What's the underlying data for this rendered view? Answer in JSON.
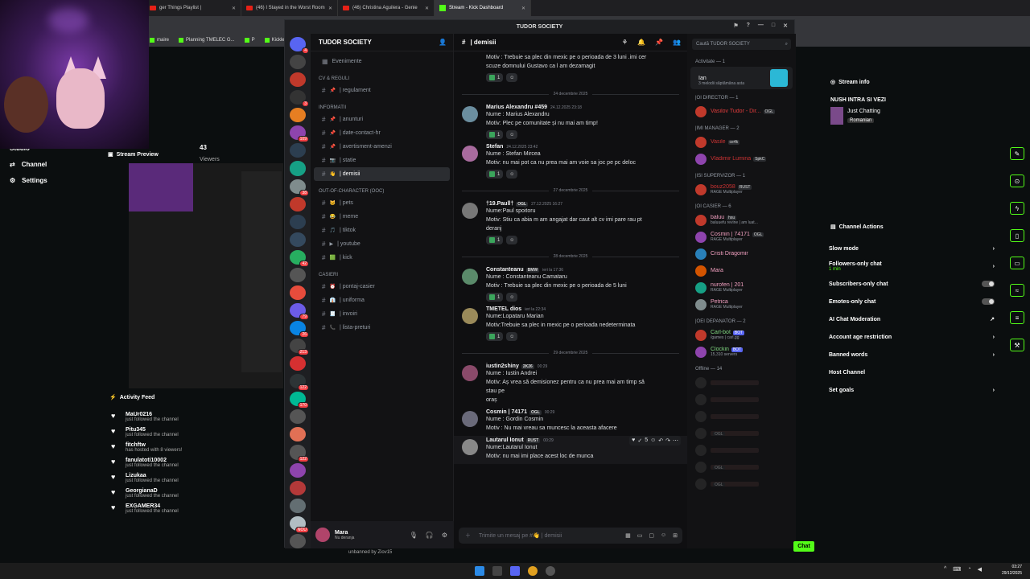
{
  "browser": {
    "tabs": [
      {
        "label": "ger Things Playlist |",
        "active": false
      },
      {
        "label": "(46) I Stayed in the Worst Room",
        "active": false
      },
      {
        "label": "(46) Christina Aguilera - Genie",
        "active": false
      },
      {
        "label": "Stream - Kick Dashboard",
        "active": true
      }
    ],
    "bookmarks": [
      "maire",
      "Planning TMELEC G...",
      "P",
      "Kicklet.app -"
    ]
  },
  "kick": {
    "nav": {
      "studio": "Studio",
      "channel": "Channel",
      "settings": "Settings"
    },
    "viewers": {
      "count": "43",
      "label": "Viewers"
    },
    "stream_preview_title": "Stream Preview",
    "activity_feed_title": "Activity Feed",
    "activity_feed": [
      {
        "name": "MaUr0216",
        "sub": "just followed the channel"
      },
      {
        "name": "Pitu345",
        "sub": "just followed the channel"
      },
      {
        "name": "fitchftw",
        "sub": "has hosted with 8 viewers!"
      },
      {
        "name": "fanulatoti10002",
        "sub": "just followed the channel"
      },
      {
        "name": "Lizukaa",
        "sub": "just followed the channel"
      },
      {
        "name": "GeorgianaD",
        "sub": "just followed the channel"
      },
      {
        "name": "EXGAMER34",
        "sub": "just followed the channel"
      }
    ],
    "stream_info": {
      "title": "Stream info",
      "stream_title": "NUSH INTRA SI VEZI",
      "category": "Just Chatting",
      "tag": "Romanian"
    },
    "channel_actions": {
      "title": "Channel Actions",
      "items": [
        {
          "label": "Slow mode",
          "control": "chevron"
        },
        {
          "label": "Followers-only chat",
          "sub": "1 min",
          "control": "chevron"
        },
        {
          "label": "Subscribers-only chat",
          "control": "toggle"
        },
        {
          "label": "Emotes-only chat",
          "control": "toggle"
        },
        {
          "label": "AI Chat Moderation",
          "control": "link"
        },
        {
          "label": "Account age restriction",
          "control": "chevron"
        },
        {
          "label": "Banned words",
          "control": "chevron"
        },
        {
          "label": "Host Channel",
          "control": "none"
        },
        {
          "label": "Set goals",
          "control": "chevron"
        }
      ]
    },
    "chat_button": "Chat",
    "unbanned_text": "unbanned by Ziov15"
  },
  "discord": {
    "window_title": "TUDOR SOCIETY",
    "guild_name": "TUDOR SOCIETY",
    "categories": [
      {
        "name": "",
        "channels": [
          {
            "emoji": "",
            "name": "Evenimente",
            "type": "event"
          }
        ]
      },
      {
        "name": "CV & REGULI",
        "channels": [
          {
            "emoji": "📌",
            "name": "| regulament"
          }
        ]
      },
      {
        "name": "INFORMATII",
        "channels": [
          {
            "emoji": "📌",
            "name": "| anunturi"
          },
          {
            "emoji": "📌",
            "name": "| date-contact-hr"
          },
          {
            "emoji": "📌",
            "name": "| avertisment-amenzi"
          },
          {
            "emoji": "📷",
            "name": "| statie"
          },
          {
            "emoji": "👋",
            "name": "| demisii",
            "active": true
          }
        ]
      },
      {
        "name": "OUT-OF-CHARACTER (OOC)",
        "channels": [
          {
            "emoji": "🐱",
            "name": "| pets"
          },
          {
            "emoji": "😂",
            "name": "| meme"
          },
          {
            "emoji": "🎵",
            "name": "| tiktok"
          },
          {
            "emoji": "▶",
            "name": "| youtube"
          },
          {
            "emoji": "🟩",
            "name": "| kick"
          }
        ]
      },
      {
        "name": "CASIERI",
        "channels": [
          {
            "emoji": "⏰",
            "name": "| pontaj-casier"
          },
          {
            "emoji": "👔",
            "name": "| uniforma"
          },
          {
            "emoji": "🧾",
            "name": "| invoiri"
          },
          {
            "emoji": "📞",
            "name": "| lista-preturi"
          }
        ]
      }
    ],
    "user": {
      "name": "Mara",
      "status": "Nu deranja"
    },
    "channel_header": "| demisii",
    "search_placeholder": "Caută TUDOR SOCIETY",
    "composer_placeholder": "Trimite un mesaj pe #👋 | demisii",
    "messages": [
      {
        "type": "partial",
        "lines": [
          "Motiv : Trebuie sa plec din mexic pe o perioada de 3 luni .imi cer",
          "scuze domnului Gustavo ca l am dezamagit"
        ],
        "reacts": "1"
      },
      {
        "type": "date",
        "label": "24 decembrie 2025"
      },
      {
        "type": "msg",
        "author": "Marius Alexandru #459",
        "ts": "24.12.2025 23:18",
        "lines": [
          "Nume : Marius Alexandru",
          "Motiv: Plec pe comunitate și nu mai am timp!"
        ],
        "reacts": "1",
        "color": "#6b8e9f"
      },
      {
        "type": "msg",
        "author": "Stefan",
        "ts": "24.12.2025 23:42",
        "lines": [
          "Nume : Stefan Mircea",
          "Motiv: nu mai pot ca nu prea mai  am voie sa joc pe pc deloc"
        ],
        "reacts": "1",
        "color": "#a86b9e"
      },
      {
        "type": "date",
        "label": "27 decembrie 2025"
      },
      {
        "type": "msg",
        "author": "†19.Paull†",
        "tag": "OGL",
        "ts": "27.12.2025 16:27",
        "lines": [
          "Nume:Paul spoitoru",
          "Motiv: Stiu ca abia m am angajat dar caut alt cv imi pare rau pt",
          "deranj"
        ],
        "reacts": "1",
        "color": "#777"
      },
      {
        "type": "date",
        "label": "28 decembrie 2025"
      },
      {
        "type": "msg",
        "author": "Constanteanu",
        "tag": "BMW",
        "ts": "ieri la 17:36",
        "lines": [
          "Nume : Constanteanu Camataru",
          "Motiv : Trebuie sa plec din mexic pe o perioada de 5 luni"
        ],
        "reacts": "1",
        "color": "#5a8a6a"
      },
      {
        "type": "msg",
        "author": "TMETEL dios",
        "ts": "ieri la 22:34",
        "lines": [
          "Nume:Lopataru Marian",
          "Motiv:Trebuie sa plec in mexic pe o perioada nedeterminata"
        ],
        "reacts": "1",
        "color": "#9a8a5a"
      },
      {
        "type": "date",
        "label": "29 decembrie 2025"
      },
      {
        "type": "msg",
        "author": "iustin2shiny",
        "tag": "2K26",
        "ts": "00:29",
        "lines": [
          "Nume : Iustin Andrei",
          "Motiv: Aș vrea să demisionez pentru ca nu prea mai am timp să",
          "stau pe",
          "oraș"
        ],
        "reacts": "",
        "color": "#8a4a6a"
      },
      {
        "type": "msg",
        "author": "Cosmin | 74171",
        "tag": "OGL",
        "ts": "00:29",
        "lines": [
          "Nume : Gordin Cosmin",
          "Motiv : Nu mai vreau sa muncesc la aceasta afacere"
        ],
        "reacts": "",
        "color": "#6a6a7a"
      },
      {
        "type": "msg",
        "author": "Lautarul Ionut",
        "tag": "RUST",
        "ts": "00:29",
        "lines": [
          "Nume:Lautarul Ionut",
          "Motiv: nu mai imi place acest loc de munca"
        ],
        "reacts": "",
        "color": "#888",
        "hover": true
      }
    ],
    "members": {
      "activity": "Activitate — 1",
      "activity_item": {
        "name": "Ian",
        "sub": "3 melodii săptămâna asta"
      },
      "groups": [
        {
          "label": "|OI DIRECTOR — 1",
          "members": [
            {
              "name": "Vasilov Tudor - Dir...",
              "tag": "OGL",
              "color": "#e03c3c"
            }
          ]
        },
        {
          "label": "|IMI MANAGER — 2",
          "members": [
            {
              "name": "Vasile",
              "tag": "ce4k",
              "color": "#c33"
            },
            {
              "name": "Vladimir Lumina",
              "tag": "SpkC",
              "color": "#c33"
            }
          ]
        },
        {
          "label": "|ISI SUPERVIZOR — 1",
          "members": [
            {
              "name": "bouz2058",
              "sub": "RAGE Multiplayer",
              "tag": "RUST",
              "color": "#c33"
            }
          ]
        },
        {
          "label": "|OI CASIER — 6",
          "members": [
            {
              "name": "baluu",
              "sub": "baluuefu revine | am luat...",
              "tag": "hsu",
              "color": "#f2a0c0"
            },
            {
              "name": "Cosmin | 74171",
              "sub": "RAGE Multiplayer",
              "tag": "OGL",
              "color": "#f2a0c0"
            },
            {
              "name": "Cristi Dragomir",
              "color": "#f2a0c0"
            },
            {
              "name": "Mara",
              "color": "#f2a0c0"
            },
            {
              "name": "nurofen | 201",
              "sub": "RAGE Multiplayer",
              "color": "#f2a0c0"
            },
            {
              "name": "Petrica",
              "sub": "RAGE Multiplayer",
              "color": "#f2a0c0"
            }
          ]
        },
        {
          "label": "|OEI DEPANATOR — 2",
          "members": [
            {
              "name": "Carl-bot",
              "sub": "/games | carl.gg",
              "bot": "BOT",
              "color": "#7fd67f"
            },
            {
              "name": "Clockin",
              "sub": "15,310 servers",
              "bot": "BOT",
              "color": "#7fd67f"
            }
          ]
        },
        {
          "label": "Offline — 14",
          "members": [
            {
              "name": "",
              "offline": true
            },
            {
              "name": "",
              "offline": true
            },
            {
              "name": "",
              "offline": true
            },
            {
              "name": "",
              "tag": "OGL",
              "offline": true
            },
            {
              "name": "",
              "offline": true
            },
            {
              "name": "",
              "tag": "OGL",
              "offline": true
            },
            {
              "name": "",
              "tag": "OGL",
              "offline": true
            }
          ]
        }
      ]
    }
  },
  "taskbar": {
    "time": "03:27",
    "date": "29/12/2025"
  }
}
